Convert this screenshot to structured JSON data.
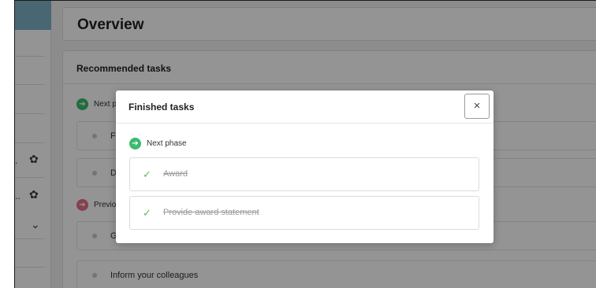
{
  "colors": {
    "sidebar_accent": "#7fb2c5",
    "next_phase": "#3cba6e",
    "previous_phase": "#e36f86",
    "check": "#5cb85c"
  },
  "sidebar": {
    "items": [
      {
        "prefix": ".",
        "icon": "gear-icon"
      },
      {
        "prefix": "..",
        "icon": "gear-icon"
      },
      {
        "prefix": "",
        "icon": "chevron-down-icon"
      }
    ]
  },
  "overview": {
    "title": "Overview"
  },
  "tasks": {
    "title": "Recommended tasks",
    "next_phase_label": "Next p",
    "previous_phase_label": "Previo",
    "items": [
      {
        "label": "F"
      },
      {
        "label": "D"
      },
      {
        "label": "G"
      },
      {
        "label": "Inform your colleagues"
      }
    ]
  },
  "modal": {
    "title": "Finished tasks",
    "close_label": "×",
    "phase_label": "Next phase",
    "completed": [
      {
        "label": "Award"
      },
      {
        "label": "Provide award statement"
      }
    ]
  }
}
